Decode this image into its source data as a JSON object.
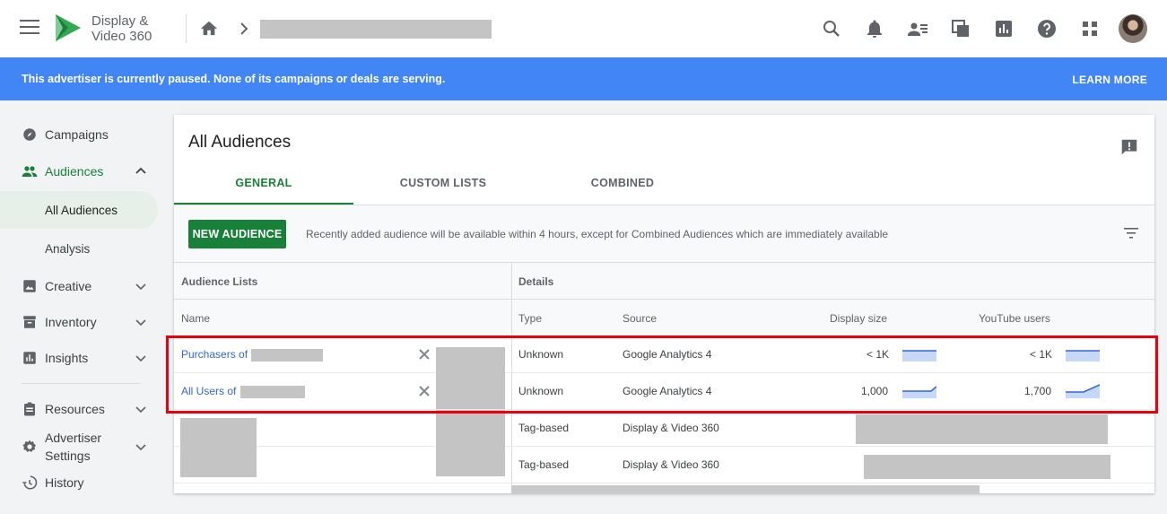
{
  "app": {
    "brand_line1": "Display &",
    "brand_line2": "Video 360"
  },
  "banner": {
    "message": "This advertiser is currently paused. None of its campaigns or deals are serving.",
    "link": "LEARN MORE"
  },
  "sidebar": {
    "items": [
      {
        "label": "Campaigns"
      },
      {
        "label": "Audiences"
      },
      {
        "label": "All Audiences"
      },
      {
        "label": "Analysis"
      },
      {
        "label": "Creative"
      },
      {
        "label": "Inventory"
      },
      {
        "label": "Insights"
      },
      {
        "label": "Resources"
      },
      {
        "label_line1": "Advertiser",
        "label_line2": "Settings"
      },
      {
        "label": "History"
      }
    ]
  },
  "page": {
    "title": "All Audiences",
    "tabs": [
      "GENERAL",
      "CUSTOM LISTS",
      "COMBINED"
    ],
    "new_button": "NEW AUDIENCE",
    "hint": "Recently added audience will be available within 4 hours, except for Combined Audiences which are immediately available"
  },
  "table": {
    "group_headers": [
      "Audience Lists",
      "Details"
    ],
    "columns": [
      "Name",
      "Type",
      "Source",
      "Display size",
      "YouTube users"
    ],
    "rows": [
      {
        "name": "Purchasers of f",
        "type": "Unknown",
        "source": "Google Analytics 4",
        "display_size": "< 1K",
        "youtube_users": "< 1K"
      },
      {
        "name": "All Users of",
        "type": "Unknown",
        "source": "Google Analytics 4",
        "display_size": "1,000",
        "youtube_users": "1,700"
      },
      {
        "name": "",
        "type": "Tag-based",
        "source": "Display & Video 360",
        "display_size": "",
        "youtube_users": ""
      },
      {
        "name": "",
        "type": "Tag-based",
        "source": "Display & Video 360",
        "display_size": "",
        "youtube_users": ""
      }
    ]
  },
  "colors": {
    "accent": "#188038",
    "banner": "#4285f4",
    "link": "#3367d6",
    "highlight": "#e8000b"
  }
}
